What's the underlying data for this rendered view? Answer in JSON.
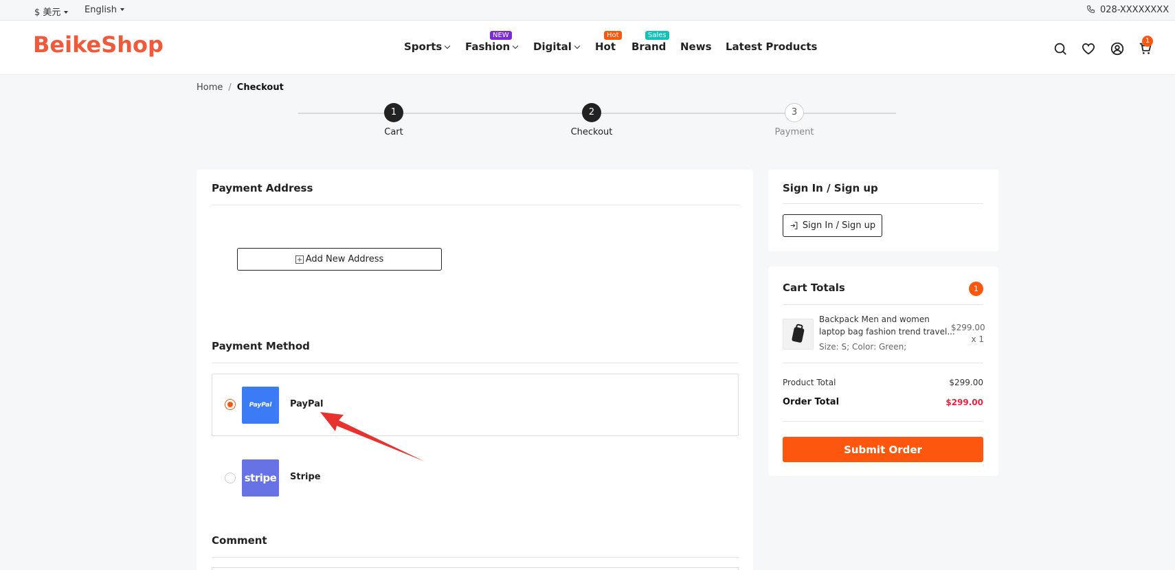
{
  "topbar": {
    "currency": "$ 美元",
    "language": "English",
    "phone": "028-XXXXXXXX"
  },
  "header": {
    "logo": "BeikeShop",
    "nav": [
      {
        "label": "Sports",
        "dropdown": true
      },
      {
        "label": "Fashion",
        "dropdown": true,
        "badge": "NEW",
        "badge_color": "#7b2bd6"
      },
      {
        "label": "Digital",
        "dropdown": true
      },
      {
        "label": "Hot",
        "badge": "Hot",
        "badge_color": "#fd560f"
      },
      {
        "label": "Brand",
        "badge": "Sales",
        "badge_color": "#12c2b8"
      },
      {
        "label": "News"
      },
      {
        "label": "Latest Products"
      }
    ],
    "icons": [
      "search-icon",
      "heart-icon",
      "user-icon",
      "cart-icon"
    ],
    "cart_count": "1"
  },
  "breadcrumb": {
    "home": "Home",
    "current": "Checkout"
  },
  "steps": [
    {
      "num": "1",
      "label": "Cart"
    },
    {
      "num": "2",
      "label": "Checkout"
    },
    {
      "num": "3",
      "label": "Payment"
    }
  ],
  "payment_address": {
    "title": "Payment Address",
    "add_button": "Add New Address"
  },
  "payment_method": {
    "title": "Payment Method",
    "options": [
      {
        "name": "PayPal",
        "logo_text": "PayPal",
        "logo_color": "#3b7bf6",
        "selected": true
      },
      {
        "name": "Stripe",
        "logo_text": "stripe",
        "logo_color": "#6772e5",
        "selected": false
      }
    ]
  },
  "comment": {
    "title": "Comment"
  },
  "signin": {
    "title": "Sign In / Sign up",
    "button": "Sign In / Sign up"
  },
  "cart_totals": {
    "title": "Cart Totals",
    "count": "1",
    "item": {
      "name_line1": "Backpack Men and women",
      "name_line2": "laptop bag fashion trend travel...",
      "variant": "Size: S; Color: Green;",
      "price": "$299.00",
      "qty": "x 1"
    },
    "product_total_label": "Product Total",
    "product_total": "$299.00",
    "order_total_label": "Order Total",
    "order_total": "$299.00",
    "submit": "Submit Order"
  },
  "colors": {
    "accent": "#fd560f",
    "logo": "#f05a3a",
    "price_red": "#e3263f"
  }
}
